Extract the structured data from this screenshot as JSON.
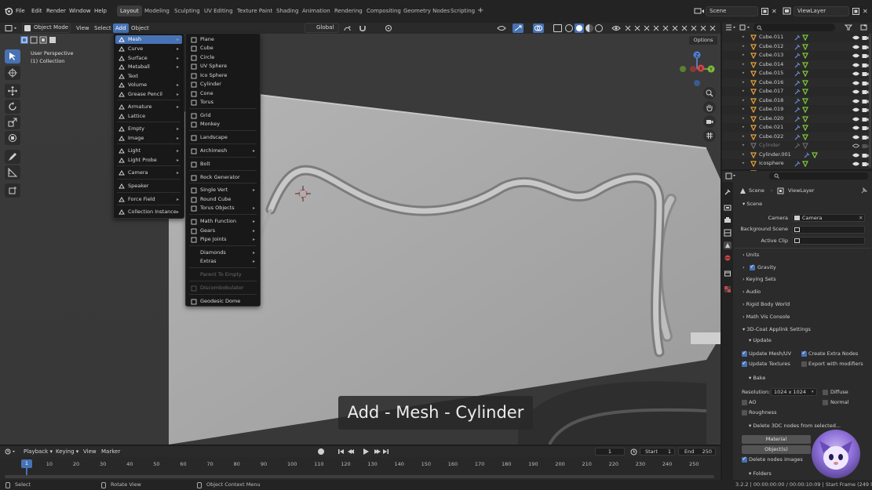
{
  "topbar": {
    "menus": [
      "File",
      "Edit",
      "Render",
      "Window",
      "Help"
    ],
    "workspaces": [
      "Layout",
      "Modeling",
      "Sculpting",
      "UV Editing",
      "Texture Paint",
      "Shading",
      "Animation",
      "Rendering",
      "Compositing",
      "Geometry Nodes",
      "Scripting"
    ],
    "active_workspace": "Layout",
    "scene": "Scene",
    "view_layer": "ViewLayer"
  },
  "viewport_header": {
    "mode": "Object Mode",
    "menus": [
      "View",
      "Select",
      "Add",
      "Object"
    ],
    "transform": "Global",
    "options": "Options"
  },
  "viewport_info": {
    "view": "User Perspective",
    "collection": "(1) Collection"
  },
  "add_menu": {
    "items": [
      {
        "label": "Mesh",
        "icon": "mesh-icon",
        "submenu": true,
        "highlighted": true
      },
      {
        "label": "Curve",
        "icon": "curve-icon",
        "submenu": true
      },
      {
        "label": "Surface",
        "icon": "surface-icon",
        "submenu": true
      },
      {
        "label": "Metaball",
        "icon": "metaball-icon",
        "submenu": true
      },
      {
        "label": "Text",
        "icon": "text-icon",
        "submenu": false
      },
      {
        "label": "Volume",
        "icon": "volume-icon",
        "submenu": true
      },
      {
        "label": "Grease Pencil",
        "icon": "grease-pencil-icon",
        "submenu": true
      },
      {
        "label": "Armature",
        "icon": "armature-icon",
        "submenu": true
      },
      {
        "label": "Lattice",
        "icon": "lattice-icon",
        "submenu": false
      },
      {
        "label": "Empty",
        "icon": "empty-icon",
        "submenu": true
      },
      {
        "label": "Image",
        "icon": "image-icon",
        "submenu": true
      },
      {
        "label": "Light",
        "icon": "light-icon",
        "submenu": true
      },
      {
        "label": "Light Probe",
        "icon": "light-probe-icon",
        "submenu": true
      },
      {
        "label": "Camera",
        "icon": "camera-icon",
        "submenu": true
      },
      {
        "label": "Speaker",
        "icon": "speaker-icon",
        "submenu": false
      },
      {
        "label": "Force Field",
        "icon": "force-field-icon",
        "submenu": true
      },
      {
        "label": "Collection Instance",
        "icon": "collection-instance-icon",
        "submenu": true
      }
    ]
  },
  "mesh_menu": {
    "items": [
      {
        "label": "Plane",
        "icon": "plane-icon"
      },
      {
        "label": "Cube",
        "icon": "cube-icon"
      },
      {
        "label": "Circle",
        "icon": "circle-icon"
      },
      {
        "label": "UV Sphere",
        "icon": "uv-sphere-icon"
      },
      {
        "label": "Ico Sphere",
        "icon": "ico-sphere-icon"
      },
      {
        "label": "Cylinder",
        "icon": "cylinder-icon"
      },
      {
        "label": "Cone",
        "icon": "cone-icon"
      },
      {
        "label": "Torus",
        "icon": "torus-icon"
      },
      {
        "label": "Grid",
        "icon": "grid-icon"
      },
      {
        "label": "Monkey",
        "icon": "monkey-icon"
      },
      {
        "label": "Landscape",
        "icon": "landscape-icon"
      },
      {
        "label": "Archimesh",
        "icon": "archimesh-icon",
        "submenu": true
      },
      {
        "label": "Bolt",
        "icon": "bolt-icon"
      },
      {
        "label": "Rock Generator",
        "icon": "rock-icon"
      },
      {
        "label": "Single Vert",
        "icon": "vert-icon",
        "submenu": true
      },
      {
        "label": "Round Cube",
        "icon": "round-cube-icon"
      },
      {
        "label": "Torus Objects",
        "icon": "torus-objects-icon",
        "submenu": true
      },
      {
        "label": "Math Function",
        "icon": "math-icon",
        "submenu": true
      },
      {
        "label": "Gears",
        "icon": "gear-icon",
        "submenu": true
      },
      {
        "label": "Pipe Joints",
        "icon": "pipe-icon",
        "submenu": true
      },
      {
        "label": "Diamonds",
        "icon": "",
        "submenu": true
      },
      {
        "label": "Extras",
        "icon": "",
        "submenu": true
      },
      {
        "label": "Parent To Empty",
        "icon": "",
        "disabled": true
      },
      {
        "label": "Discombobulator",
        "icon": "discombobulator-icon",
        "disabled": true
      },
      {
        "label": "Geodesic Dome",
        "icon": "geodesic-icon"
      }
    ]
  },
  "caption": "Add - Mesh - Cylinder",
  "outliner": {
    "rows": [
      {
        "name": "Cube.011",
        "dim": false
      },
      {
        "name": "Cube.012",
        "dim": false
      },
      {
        "name": "Cube.013",
        "dim": false
      },
      {
        "name": "Cube.014",
        "dim": false
      },
      {
        "name": "Cube.015",
        "dim": false
      },
      {
        "name": "Cube.016",
        "dim": false
      },
      {
        "name": "Cube.017",
        "dim": false
      },
      {
        "name": "Cube.018",
        "dim": false
      },
      {
        "name": "Cube.019",
        "dim": false
      },
      {
        "name": "Cube.020",
        "dim": false
      },
      {
        "name": "Cube.021",
        "dim": false
      },
      {
        "name": "Cube.022",
        "dim": false
      },
      {
        "name": "Cylinder",
        "dim": true
      },
      {
        "name": "Cylinder.001",
        "dim": false
      },
      {
        "name": "Icosphere",
        "dim": false
      }
    ]
  },
  "properties": {
    "breadcrumb_scene": "Scene",
    "breadcrumb_layer": "ViewLayer",
    "panel_scene": "Scene",
    "camera_label": "Camera",
    "camera_value": "Camera",
    "bg_scene_label": "Background Scene",
    "active_clip_label": "Active Clip",
    "units": "Units",
    "gravity": "Gravity",
    "keying_sets": "Keying Sets",
    "audio": "Audio",
    "rigid_body": "Rigid Body World",
    "math_vis": "Math Vis Console",
    "coat_panel": "3D-Coat Applink Settings",
    "update": "Update",
    "update_mesh": "Update Mesh/UV",
    "create_nodes": "Create Extra Nodes",
    "update_textures": "Update Textures",
    "export_modifiers": "Export with modifiers",
    "bake": "Bake",
    "resolution_label": "Resolution:",
    "resolution_value": "1024 x 1024",
    "diffuse": "Diffuse",
    "ao": "AO",
    "normal": "Normal",
    "roughness": "Roughness",
    "delete_nodes": "Delete 3DC nodes from selected...",
    "material": "Material",
    "objects": "Object(s)",
    "delete_images": "Delete nodes images",
    "folders": "Folders"
  },
  "timeline": {
    "menus": [
      "Playback",
      "Keying",
      "View",
      "Marker"
    ],
    "current_frame": "1",
    "start_label": "Start",
    "start_value": "1",
    "end_label": "End",
    "end_value": "250",
    "ticks": [
      "1",
      "10",
      "20",
      "30",
      "40",
      "50",
      "60",
      "70",
      "80",
      "90",
      "100",
      "110",
      "120",
      "130",
      "140",
      "150",
      "160",
      "170",
      "180",
      "190",
      "200",
      "210",
      "220",
      "230",
      "240",
      "250"
    ]
  },
  "status": {
    "select": "Select",
    "rotate": "Rotate View",
    "context": "Object Context Menu",
    "version": "3.2.2 | 00:00:00:00 / 00:00:10:09 | Start Frame (249 left)"
  },
  "colors": {
    "accent": "#4772b3",
    "mesh_orange": "#e8a33a",
    "mesh_green": "#7ec93b"
  }
}
